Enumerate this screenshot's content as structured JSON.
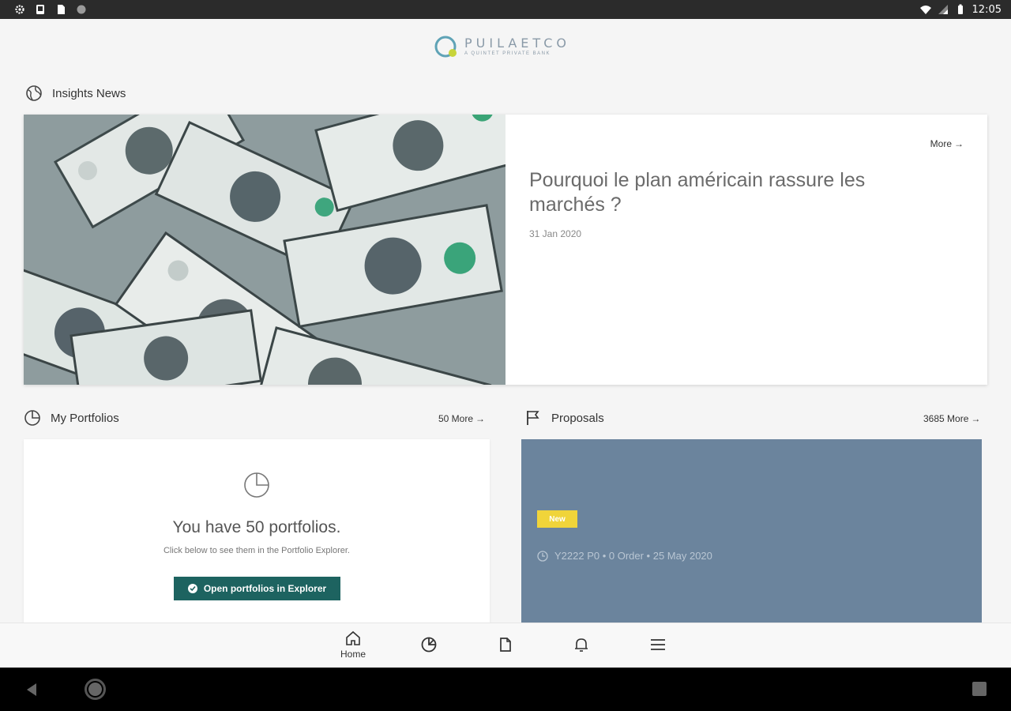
{
  "status_bar": {
    "time": "12:05",
    "left_icons": [
      "settings-icon",
      "sd-card-icon",
      "file-icon",
      "circle-icon"
    ],
    "right_icons": [
      "wifi-icon",
      "signal-icon",
      "battery-icon"
    ]
  },
  "logo": {
    "name": "PUILAETCO",
    "tagline": "A QUINTET PRIVATE BANK"
  },
  "insights": {
    "section_title": "Insights News",
    "more_label": "More",
    "article": {
      "title": "Pourquoi le plan américain rassure les marchés ?",
      "date": "31 Jan 2020",
      "image_subject": "dollar-bills"
    }
  },
  "portfolios": {
    "section_title": "My Portfolios",
    "more_label": "50 More",
    "card_title": "You have 50 portfolios.",
    "card_subtitle": "Click below to see them in the Portfolio Explorer.",
    "button_label": "Open portfolios in Explorer"
  },
  "proposals": {
    "section_title": "Proposals",
    "more_label": "3685 More",
    "badge": "New",
    "meta": "Y2222 P0 • 0 Order • 25 May 2020"
  },
  "bottom_nav": {
    "items": [
      {
        "label": "Home",
        "icon": "home-icon",
        "active": true
      },
      {
        "label": "",
        "icon": "pie-chart-icon"
      },
      {
        "label": "",
        "icon": "document-icon"
      },
      {
        "label": "",
        "icon": "bell-icon"
      },
      {
        "label": "",
        "icon": "menu-icon"
      }
    ]
  },
  "colors": {
    "accent": "#1d6360",
    "proposal_card": "#6b849d",
    "badge": "#f0d43a",
    "status_bar": "#2b2b2b"
  }
}
